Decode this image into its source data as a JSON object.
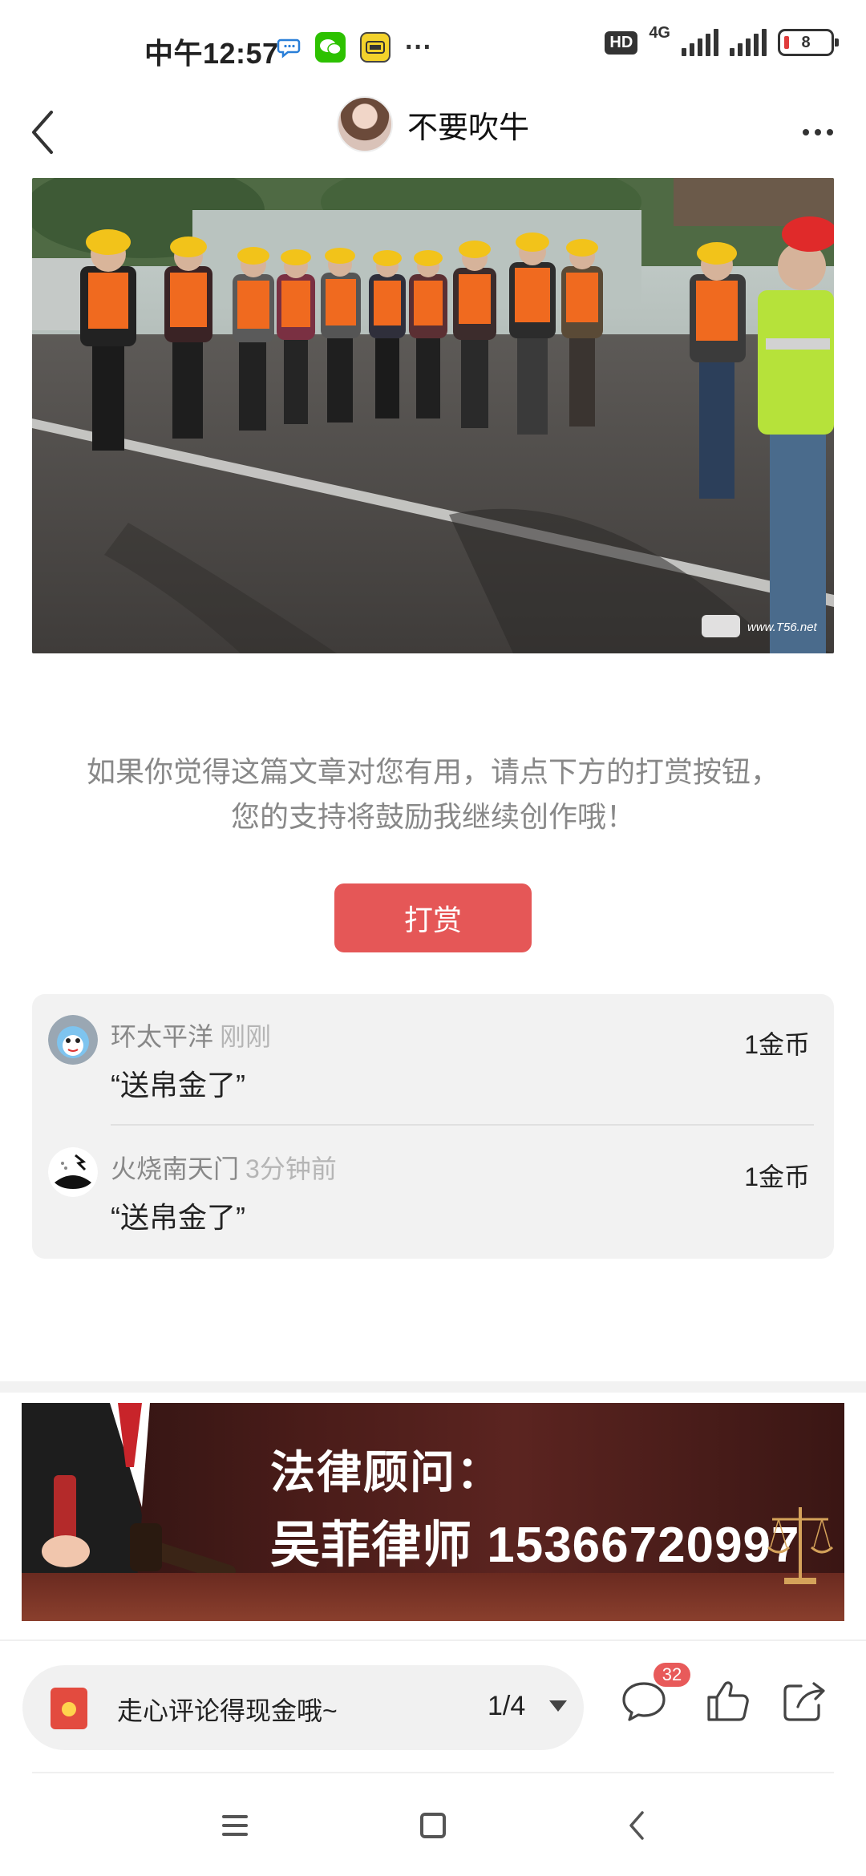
{
  "status_bar": {
    "time": "中午12:57",
    "hd": "HD",
    "network": "4G",
    "battery": "8",
    "more": "···"
  },
  "header": {
    "author_name": "不要吹牛"
  },
  "article": {
    "photo_watermark": "www.T56.net"
  },
  "reward": {
    "prompt": "如果你觉得这篇文章对您有用，请点下方的打赏按钮，您的支持将鼓励我继续创作哦！",
    "button_label": "打赏"
  },
  "tips": [
    {
      "name": "环太平洋",
      "time": "刚刚",
      "amount": "1金币",
      "message": "“送帛金了”"
    },
    {
      "name": "火烧南天门",
      "time": "3分钟前",
      "amount": "1金币",
      "message": "“送帛金了”"
    }
  ],
  "ad": {
    "title": "法律顾问：",
    "line2": "吴菲律师 15366720997"
  },
  "action_bar": {
    "comment_placeholder": "走心评论得现金哦~",
    "page_indicator": "1/4",
    "comment_count": "32"
  },
  "colors": {
    "accent": "#e55757",
    "badge": "#e85a5a"
  }
}
